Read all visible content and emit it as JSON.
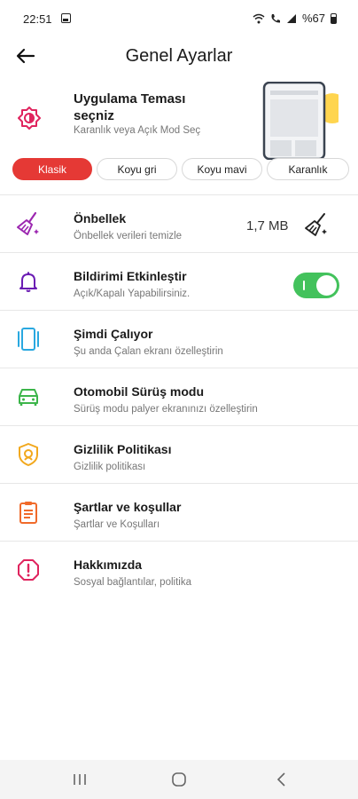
{
  "status_bar": {
    "time": "22:51",
    "battery": "%67"
  },
  "header": {
    "title": "Genel Ayarlar"
  },
  "theme": {
    "title": "Uygulama Teması seçniz",
    "subtitle": "Karanlık veya Açık Mod Seç",
    "options": [
      {
        "label": "Klasik",
        "selected": true
      },
      {
        "label": "Koyu gri",
        "selected": false
      },
      {
        "label": "Koyu mavi",
        "selected": false
      },
      {
        "label": "Karanlık",
        "selected": false
      }
    ]
  },
  "settings": [
    {
      "title": "Önbellek",
      "subtitle": "Önbellek verileri temizle",
      "value": "1,7 MB",
      "icon": "broom-icon",
      "color": "#9c27b0"
    },
    {
      "title": "Bildirimi Etkinleştir",
      "subtitle": "Açık/Kapalı Yapabilirsiniz.",
      "icon": "bell-icon",
      "color": "#6a1bb3",
      "toggle_on": true
    },
    {
      "title": "Şimdi Çalıyor",
      "subtitle": "Şu anda Çalan ekranı özelleştirin",
      "icon": "now-playing-icon",
      "color": "#29a8e0"
    },
    {
      "title": "Otomobil Sürüş modu",
      "subtitle": "Sürüş modu palyer ekranınızı özelleştirin",
      "icon": "car-icon",
      "color": "#3cb54a"
    },
    {
      "title": "Gizlilik Politikası",
      "subtitle": "Gizlilik politikası",
      "icon": "shield-icon",
      "color": "#f2a81d"
    },
    {
      "title": "Şartlar ve koşullar",
      "subtitle": "Şartlar ve Koşulları",
      "icon": "clipboard-icon",
      "color": "#f06a2a"
    },
    {
      "title": "Hakkımızda",
      "subtitle": "Sosyal bağlantılar, politika",
      "icon": "info-alert-icon",
      "color": "#e0245e"
    }
  ],
  "colors": {
    "accent": "#e53935",
    "toggle": "#43c25c",
    "theme_icon": "#e0245e"
  }
}
